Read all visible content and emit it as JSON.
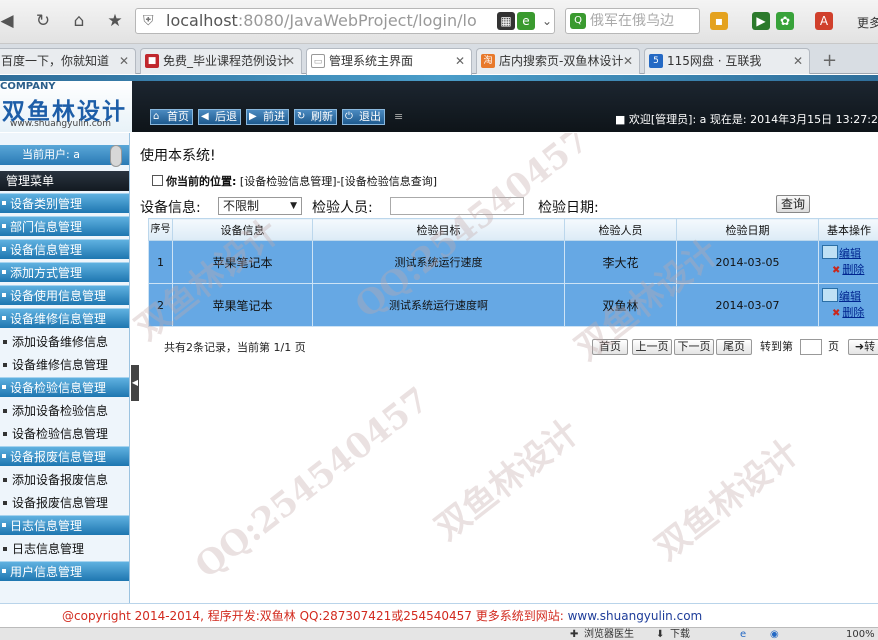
{
  "browser": {
    "url_host": "localhost",
    "url_path": ":8080/JavaWebProject/login/lo",
    "search_placeholder": "俄军在俄乌边",
    "more_label": "更多",
    "tabs": [
      {
        "label": "百度一下，你就知道",
        "favicon_color": "#2d5be3"
      },
      {
        "label": "免费_毕业课程范例设计",
        "favicon_color": "#c0272d"
      },
      {
        "label": "管理系统主界面",
        "favicon_color": "#dddddd"
      },
      {
        "label": "店内搜索页-双鱼林设计",
        "favicon_color": "#e8792b"
      },
      {
        "label": "115网盘 · 互联我",
        "favicon_color": "#2469c4"
      }
    ]
  },
  "header": {
    "company": "COMPANY",
    "logo_text": "双鱼林设计",
    "logo_url": "www.shuangyulin.com",
    "nav": [
      "首页",
      "后退",
      "前进",
      "刷新",
      "退出"
    ],
    "welcome": "■ 欢迎[管理员]: a  现在是: 2014年3月15日  13:27:2"
  },
  "sidebar": {
    "current_user": "当前用户: a",
    "menu_title": "管理菜单",
    "items": [
      {
        "type": "group",
        "label": "设备类别管理"
      },
      {
        "type": "group",
        "label": "部门信息管理"
      },
      {
        "type": "group",
        "label": "设备信息管理"
      },
      {
        "type": "group",
        "label": "添加方式管理"
      },
      {
        "type": "group",
        "label": "设备使用信息管理"
      },
      {
        "type": "group",
        "label": "设备维修信息管理"
      },
      {
        "type": "sub",
        "label": "添加设备维修信息"
      },
      {
        "type": "sub",
        "label": "设备维修信息管理"
      },
      {
        "type": "group",
        "label": "设备检验信息管理"
      },
      {
        "type": "sub",
        "label": "添加设备检验信息"
      },
      {
        "type": "sub",
        "label": "设备检验信息管理"
      },
      {
        "type": "group",
        "label": "设备报废信息管理"
      },
      {
        "type": "sub",
        "label": "添加设备报废信息"
      },
      {
        "type": "sub",
        "label": "设备报废信息管理"
      },
      {
        "type": "group",
        "label": "日志信息管理"
      },
      {
        "type": "sub",
        "label": "日志信息管理"
      },
      {
        "type": "group",
        "label": "用户信息管理"
      }
    ]
  },
  "main": {
    "system_title": "使用本系统!",
    "location_prefix": "你当前的位置:",
    "location_path": "[设备检验信息管理]-[设备检验信息查询]",
    "filter": {
      "device_label": "设备信息:",
      "device_value": "不限制",
      "inspector_label": "检验人员:",
      "date_label": "检验日期:",
      "query_button": "查询"
    },
    "table": {
      "headers": [
        "序号",
        "设备信息",
        "检验目标",
        "检验人员",
        "检验日期",
        "基本操作"
      ],
      "rows": [
        {
          "no": "1",
          "device": "苹果笔记本",
          "target": "测试系统运行速度",
          "inspector": "李大花",
          "date": "2014-03-05",
          "edit": "编辑",
          "delete": "删除"
        },
        {
          "no": "2",
          "device": "苹果笔记本",
          "target": "测试系统运行速度啊",
          "inspector": "双鱼林",
          "date": "2014-03-07",
          "edit": "编辑",
          "delete": "删除"
        }
      ]
    },
    "pager": {
      "info": "共有2条记录，当前第 1/1 页",
      "first": "首页",
      "prev": "上一页",
      "next": "下一页",
      "last": "尾页",
      "goto_label": "转到第",
      "page_unit": "页",
      "go_button": "➜转"
    }
  },
  "footer": {
    "text": "@copyright 2014-2014, 程序开发:双鱼林  QQ:287307421或254540457  更多系统到网站: ",
    "site": "www.shuangyulin.com"
  },
  "statusbar": {
    "browser_doctor": "浏览器医生",
    "download": "下载",
    "zoom": "100%"
  },
  "watermark": [
    "双鱼林设计",
    "QQ:254540457",
    "双鱼林设计"
  ]
}
